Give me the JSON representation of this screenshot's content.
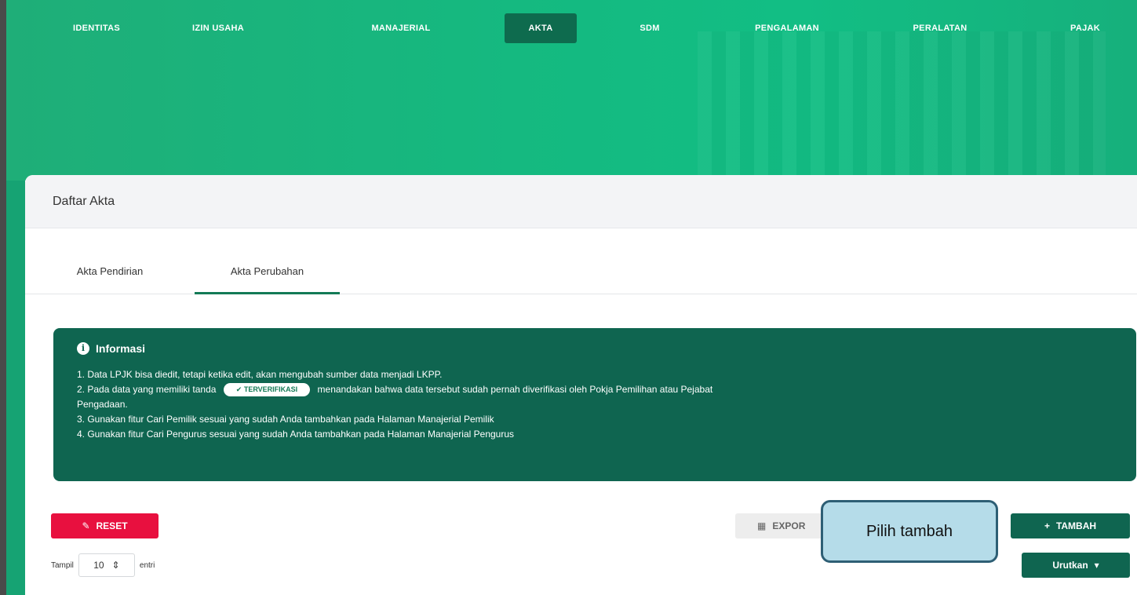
{
  "nav": {
    "items": [
      {
        "label": "IDENTITAS"
      },
      {
        "label": "IZIN USAHA"
      },
      {
        "label": "MANAJERIAL"
      },
      {
        "label": "AKTA"
      },
      {
        "label": "SDM"
      },
      {
        "label": "PENGALAMAN"
      },
      {
        "label": "PERALATAN"
      },
      {
        "label": "PAJAK"
      }
    ],
    "active": "AKTA"
  },
  "card": {
    "title": "Daftar Akta",
    "tabs": [
      {
        "label": "Akta Pendirian"
      },
      {
        "label": "Akta Perubahan"
      }
    ],
    "active_tab": "Akta Perubahan"
  },
  "info": {
    "title": "Informasi",
    "line1": "1. Data LPJK bisa diedit, tetapi ketika edit, akan mengubah sumber data menjadi LKPP.",
    "line2_pre": "2. Pada data yang memiliki tanda",
    "badge": "TERVERIFIKASI",
    "line2_post": "menandakan bahwa data tersebut sudah pernah diverifikasi oleh Pokja Pemilihan atau Pejabat",
    "line2_cont": "Pengadaan.",
    "line3": "3. Gunakan fitur Cari Pemilik sesuai yang sudah Anda tambahkan pada Halaman Manajerial Pemilik",
    "line4": "4. Gunakan fitur Cari Pengurus sesuai yang sudah Anda tambahkan pada Halaman Manajerial Pengurus"
  },
  "toolbar": {
    "reset_label": "RESET",
    "export_label": "EXPOR",
    "tambah_label": "TAMBAH",
    "urutkan_label": "Urutkan"
  },
  "entries": {
    "prefix": "Tampil",
    "value": "10",
    "suffix": "entri"
  },
  "callout": {
    "text": "Pilih tambah"
  },
  "colors": {
    "primary": "#0f6550",
    "hero": "#15b980",
    "reset": "#e8103f"
  }
}
